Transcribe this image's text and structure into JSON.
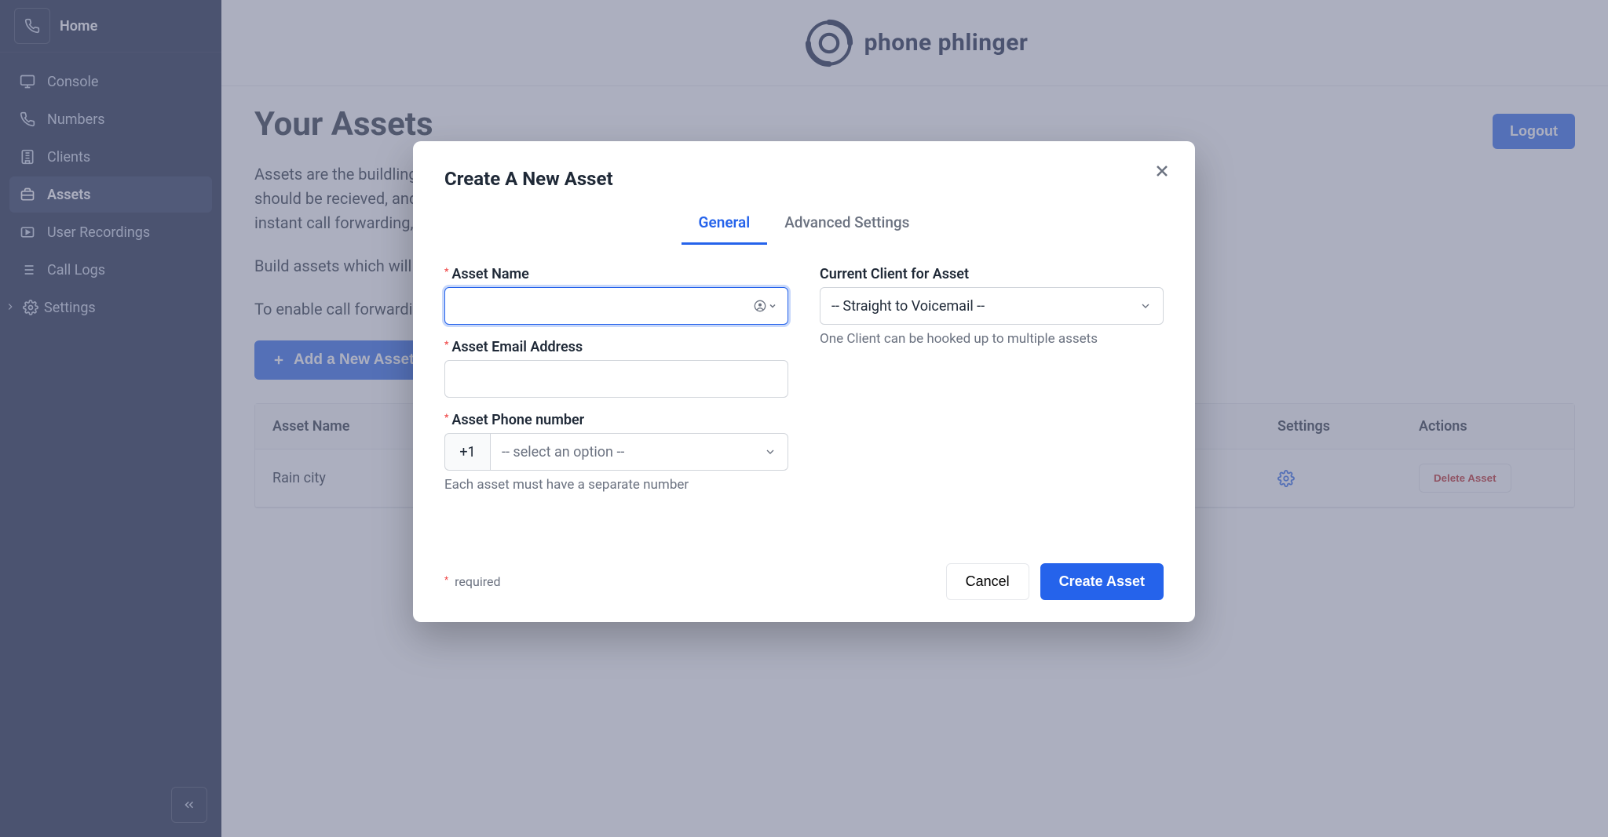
{
  "sidebar": {
    "home_label": "Home",
    "items": [
      {
        "label": "Console"
      },
      {
        "label": "Numbers"
      },
      {
        "label": "Clients"
      },
      {
        "label": "Assets"
      },
      {
        "label": "User Recordings"
      },
      {
        "label": "Call Logs"
      },
      {
        "label": "Settings"
      }
    ]
  },
  "brand": {
    "name": "phone phlinger"
  },
  "page": {
    "title": "Your Assets",
    "logout_label": "Logout",
    "desc1": "Assets are the buildling blocks of Phone Phlinger, they represent a single job-board posting. An asset represents how a call should be recieved, and can be configured to fit multiple different fields. On setting up an asset you can: assign call tracking, instant call forwarding, whisper messages, custom voicemail and more.",
    "desc2": "Build assets which will be automatically transferred once a potential client calls by setting up forwarding immidiately",
    "desc3": "To enable call forwarding you must set up *Clients* first",
    "add_button": "Add a New Asset"
  },
  "table": {
    "col_name": "Asset Name",
    "col_settings": "Settings",
    "col_actions": "Actions",
    "rows": [
      {
        "name": "Rain city",
        "delete_label": "Delete Asset"
      }
    ]
  },
  "modal": {
    "title": "Create A New Asset",
    "tabs": {
      "general": "General",
      "advanced": "Advanced Settings"
    },
    "fields": {
      "asset_name_label": "Asset Name",
      "asset_email_label": "Asset Email Address",
      "asset_phone_label": "Asset Phone number",
      "phone_country_code": "+1",
      "phone_select_placeholder": "-- select an option --",
      "phone_help": "Each asset must have a separate number",
      "client_label": "Current Client for Asset",
      "client_selected": "-- Straight to Voicemail --",
      "client_help": "One Client can be hooked up to multiple assets"
    },
    "required_note": "required",
    "cancel_label": "Cancel",
    "submit_label": "Create Asset"
  }
}
